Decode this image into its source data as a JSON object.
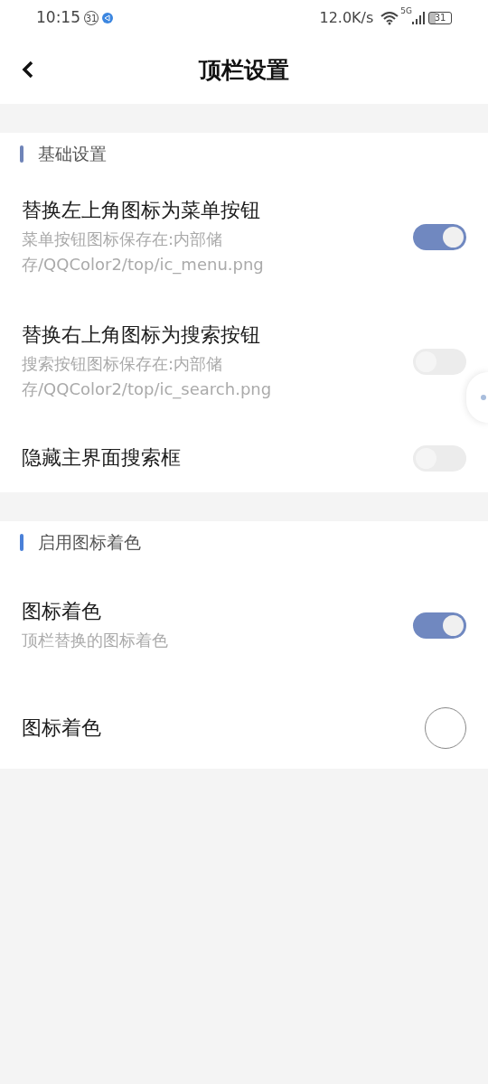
{
  "status_bar": {
    "time": "10:15",
    "notification_badge": "31",
    "network_speed": "12.0K/s",
    "network_type": "5G",
    "battery": "31"
  },
  "header": {
    "title": "顶栏设置"
  },
  "sections": [
    {
      "title": "基础设置",
      "color": "#6f84b8",
      "items": [
        {
          "kind": "switch",
          "title": "替换左上角图标为菜单按钮",
          "subtitle": "菜单按钮图标保存在:内部储存/QQColor2/top/ic_menu.png",
          "on": true
        },
        {
          "kind": "switch",
          "title": "替换右上角图标为搜索按钮",
          "subtitle": "搜索按钮图标保存在:内部储存/QQColor2/top/ic_search.png",
          "on": false
        },
        {
          "kind": "switch",
          "title": "隐藏主界面搜索框",
          "on": false
        }
      ]
    },
    {
      "title": "启用图标着色",
      "color": "#4a80d8",
      "items": [
        {
          "kind": "switch",
          "title": "图标着色",
          "subtitle": "顶栏替换的图标着色",
          "on": true
        },
        {
          "kind": "color",
          "title": "图标着色",
          "color": "#ffffff"
        }
      ]
    }
  ]
}
